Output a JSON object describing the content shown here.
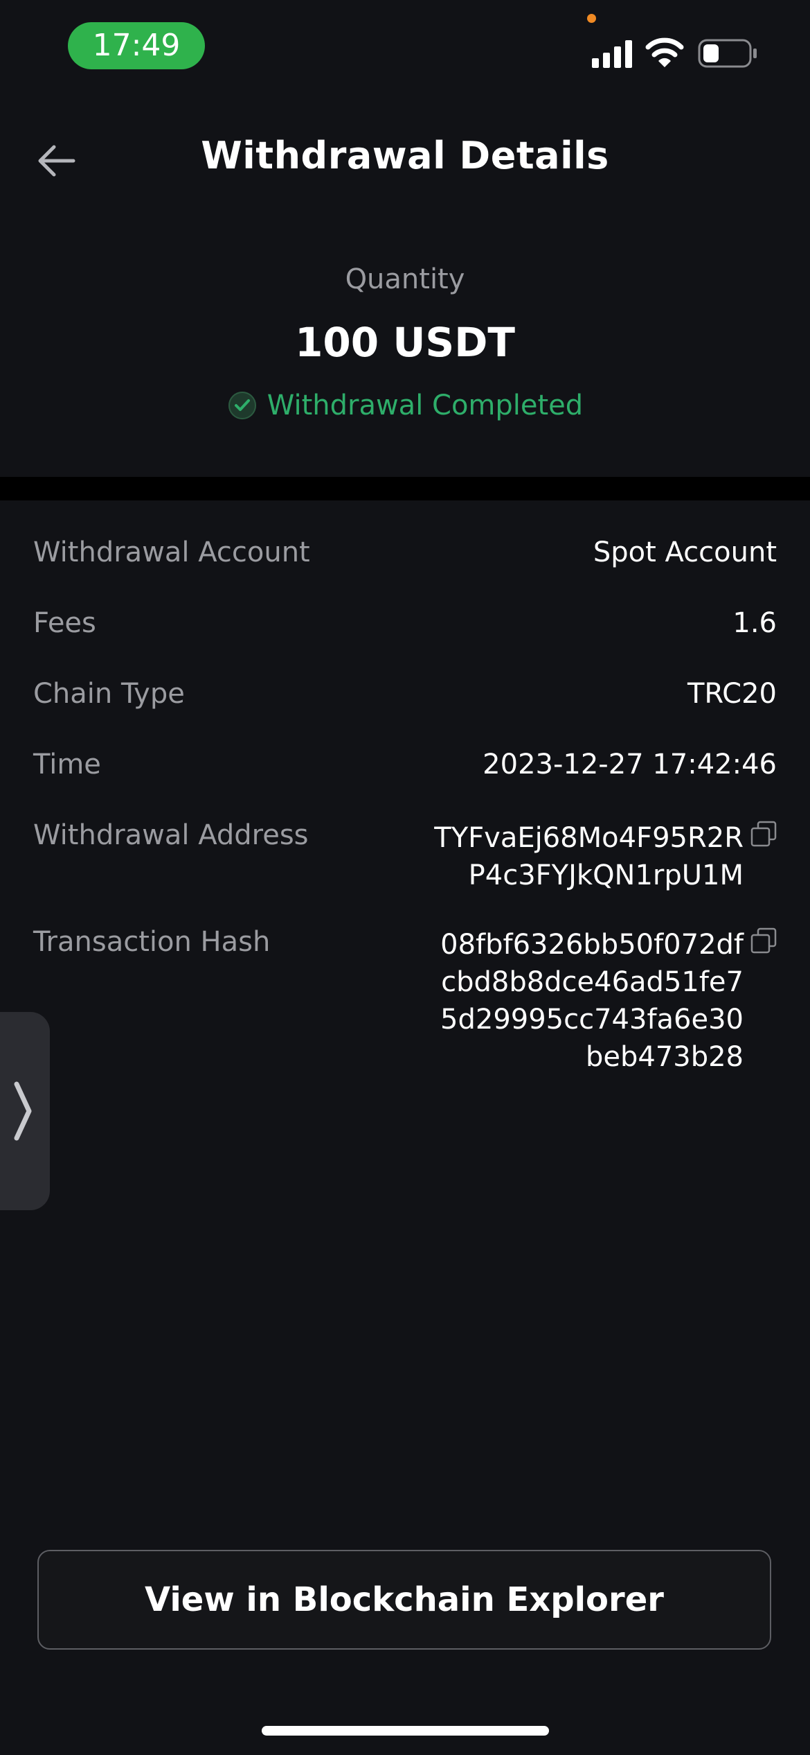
{
  "status_bar": {
    "time": "17:49"
  },
  "header": {
    "title": "Withdrawal Details"
  },
  "summary": {
    "quantity_label": "Quantity",
    "amount": "100 USDT",
    "status": "Withdrawal Completed",
    "status_color": "#2eae6a"
  },
  "details": {
    "withdrawal_account": {
      "label": "Withdrawal Account",
      "value": "Spot Account"
    },
    "fees": {
      "label": "Fees",
      "value": "1.6"
    },
    "chain_type": {
      "label": "Chain Type",
      "value": "TRC20"
    },
    "time": {
      "label": "Time",
      "value": "2023-12-27 17:42:46"
    },
    "withdrawal_address": {
      "label": "Withdrawal Address",
      "lines": [
        "TYFvaEj68Mo4F95R2R",
        "P4c3FYJkQN1rpU1M"
      ]
    },
    "transaction_hash": {
      "label": "Transaction Hash",
      "lines": [
        "08fbf6326bb50f072df",
        "cbd8b8dce46ad51fe7",
        "5d29995cc743fa6e30",
        "beb473b28"
      ]
    }
  },
  "footer": {
    "explorer_button_label": "View in Blockchain Explorer"
  },
  "colors": {
    "background": "#111216",
    "accent_green": "#2fb24c",
    "label_gray": "#9b9ca1"
  },
  "icons": [
    "back-arrow-icon",
    "signal-icon",
    "wifi-icon",
    "battery-icon",
    "check-circle-icon",
    "copy-icon",
    "chevron-right-icon"
  ]
}
